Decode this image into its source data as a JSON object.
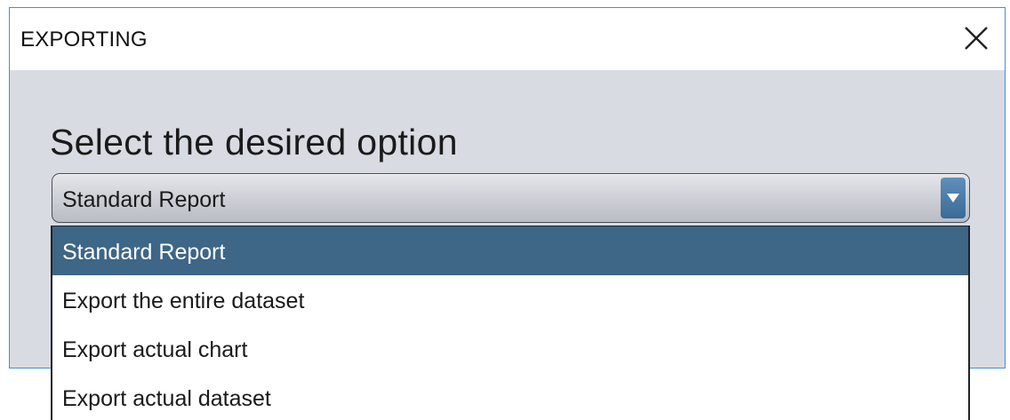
{
  "dialog": {
    "title": "EXPORTING",
    "close_icon": "close-icon",
    "prompt": "Select the desired option"
  },
  "combo": {
    "selected_value": "Standard Report",
    "arrow_icon": "chevron-down-icon"
  },
  "dropdown": {
    "options": [
      {
        "label": "Standard Report",
        "selected": true
      },
      {
        "label": "Export the entire dataset",
        "selected": false
      },
      {
        "label": "Export actual chart",
        "selected": false
      },
      {
        "label": "Export actual dataset",
        "selected": false
      }
    ]
  },
  "colors": {
    "window_border": "#4a8fd1",
    "dialog_background": "#d8dbe2",
    "selection_highlight": "#3d6687",
    "arrow_button": "#4a7aa6"
  }
}
